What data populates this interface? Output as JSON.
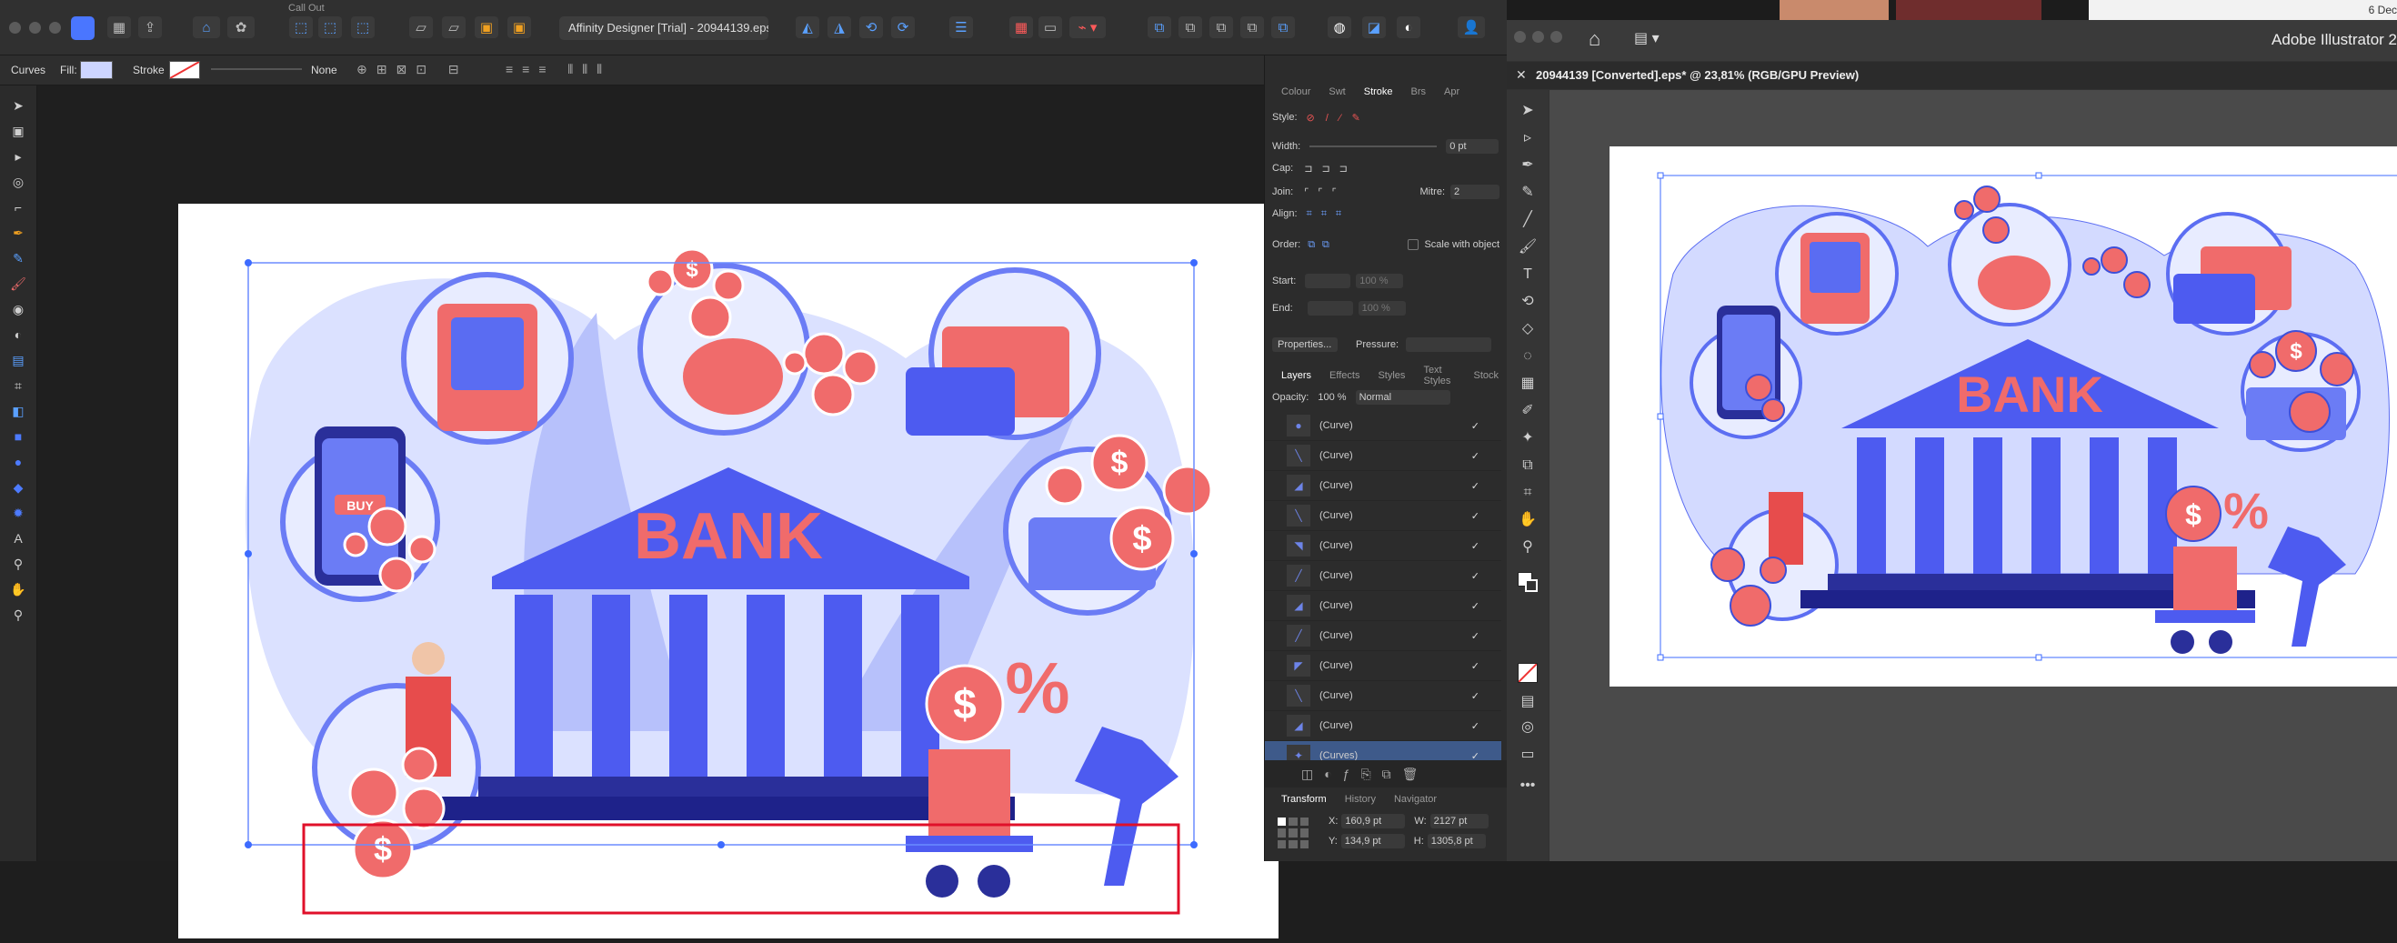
{
  "top_strip": {
    "menu_title": "Call Out",
    "date_fragment": "6 Dec"
  },
  "affinity": {
    "doc_title": "Affinity Designer [Trial] - 20944139.eps (",
    "context": {
      "tool": "Curves",
      "fill_label": "Fill:",
      "stroke_label": "Stroke",
      "stroke_value": "None"
    },
    "colors": {
      "accent": "#4d5bf0",
      "coral": "#f06b6b",
      "light": "#cdd5ff"
    },
    "panel_tabs": [
      "Colour",
      "Swt",
      "Stroke",
      "Brs",
      "Apr"
    ],
    "stroke": {
      "style_label": "Style:",
      "width_label": "Width:",
      "width_value": "0 pt",
      "cap_label": "Cap:",
      "join_label": "Join:",
      "mitre_label": "Mitre:",
      "mitre_value": "2",
      "align_label": "Align:",
      "order_label": "Order:",
      "scale_label": "Scale with object",
      "start_label": "Start:",
      "end_label": "End:",
      "start_pct": "100 %",
      "end_pct": "100 %",
      "properties_button": "Properties...",
      "pressure_label": "Pressure:"
    },
    "layer_tabs": [
      "Layers",
      "Effects",
      "Styles",
      "Text Styles",
      "Stock"
    ],
    "opacity_label": "Opacity:",
    "opacity_value": "100 %",
    "blend_mode": "Normal",
    "layers": [
      "(Curve)",
      "(Curve)",
      "(Curve)",
      "(Curve)",
      "(Curve)",
      "(Curve)",
      "(Curve)",
      "(Curve)",
      "(Curve)",
      "(Curve)",
      "(Curve)",
      "(Curves)"
    ],
    "transform_tabs": [
      "Transform",
      "History",
      "Navigator"
    ],
    "transform": {
      "x_label": "X:",
      "x": "160,9 pt",
      "y_label": "Y:",
      "y": "134,9 pt",
      "w_label": "W:",
      "w": "2127 pt",
      "h_label": "H:",
      "h": "1305,8 pt"
    },
    "art": {
      "bank": "BANK",
      "buy": "BUY",
      "dollar": "$",
      "percent": "%"
    }
  },
  "illustrator": {
    "app_title": "Adobe Illustrator 2",
    "doc_tab": "20944139 [Converted].eps* @ 23,81% (RGB/GPU Preview)",
    "art": {
      "bank": "BANK",
      "dollar": "$",
      "percent": "%"
    }
  }
}
